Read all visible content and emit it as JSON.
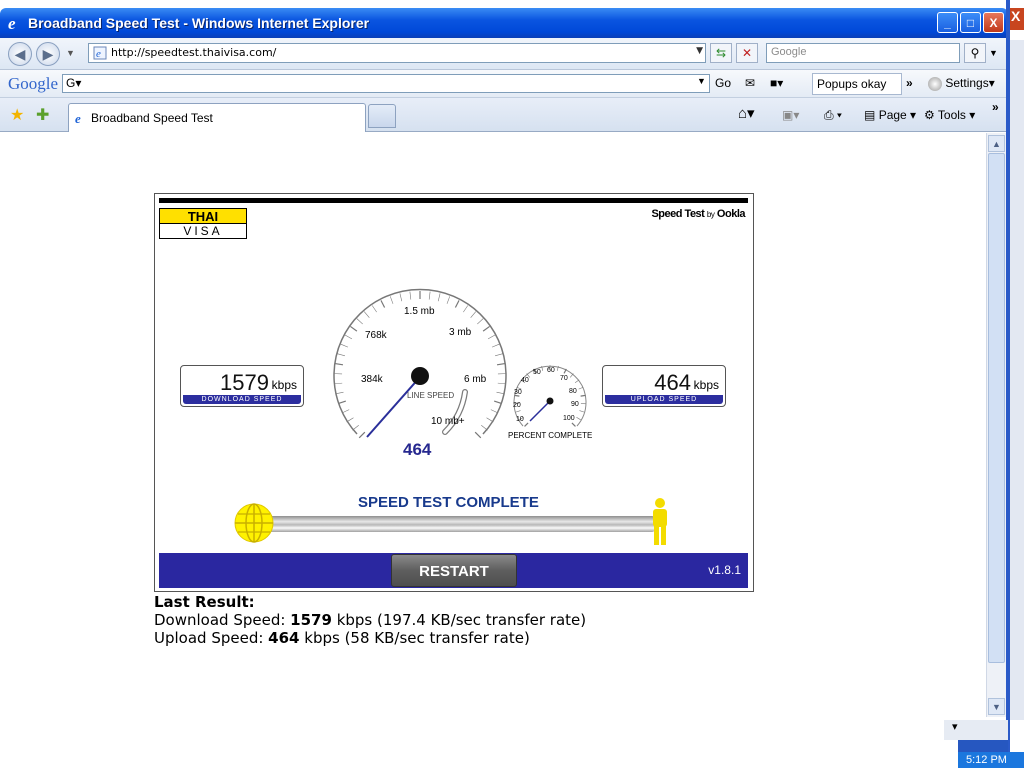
{
  "window": {
    "title": "Broadband Speed Test - Windows Internet Explorer",
    "buttons": {
      "minimize": "_",
      "maximize": "□",
      "close": "X"
    }
  },
  "addressbar": {
    "url": "http://speedtest.thaivisa.com/",
    "search_placeholder": "Google"
  },
  "google_toolbar": {
    "logo": "Google",
    "g_button": "G▾",
    "go_label": "Go",
    "popups_label": "Popups okay",
    "settings_label": "Settings▾"
  },
  "tabs": [
    {
      "label": "Broadband Speed Test"
    }
  ],
  "commandbar": {
    "page_label": "Page",
    "tools_label": "Tools"
  },
  "speedtest": {
    "logo_top": "THAI",
    "logo_bottom": "VISA",
    "brand": "Speed Test",
    "brand_by": "by",
    "brand_name": "Ookla",
    "download": {
      "value": "1579",
      "unit": "kbps",
      "label": "DOWNLOAD SPEED"
    },
    "upload": {
      "value": "464",
      "unit": "kbps",
      "label": "UPLOAD SPEED"
    },
    "gauge_labels": [
      "384k",
      "768k",
      "1.5 mb",
      "3 mb",
      "6 mb",
      "10 mb+"
    ],
    "gauge_title": "LINE SPEED",
    "line_speed_value": "464",
    "percent_labels": [
      "10",
      "20",
      "30",
      "40",
      "50",
      "60",
      "70",
      "80",
      "90",
      "100"
    ],
    "percent_title": "PERCENT COMPLETE",
    "status": "SPEED TEST COMPLETE",
    "restart_label": "RESTART",
    "version": "v1.8.1"
  },
  "results": {
    "heading": "Last Result:",
    "download_prefix": "Download Speed: ",
    "download_value": "1579",
    "download_suffix": " kbps (197.4 KB/sec transfer rate)",
    "upload_prefix": "Upload Speed: ",
    "upload_value": "464",
    "upload_suffix": " kbps (58 KB/sec transfer rate)"
  },
  "taskbar": {
    "clock": "5:12 PM"
  },
  "colors": {
    "title_blue": "#0a55e0",
    "bar_navy": "#2a27a0",
    "logo_yellow": "#ffe000",
    "status_blue": "#183a8c"
  }
}
